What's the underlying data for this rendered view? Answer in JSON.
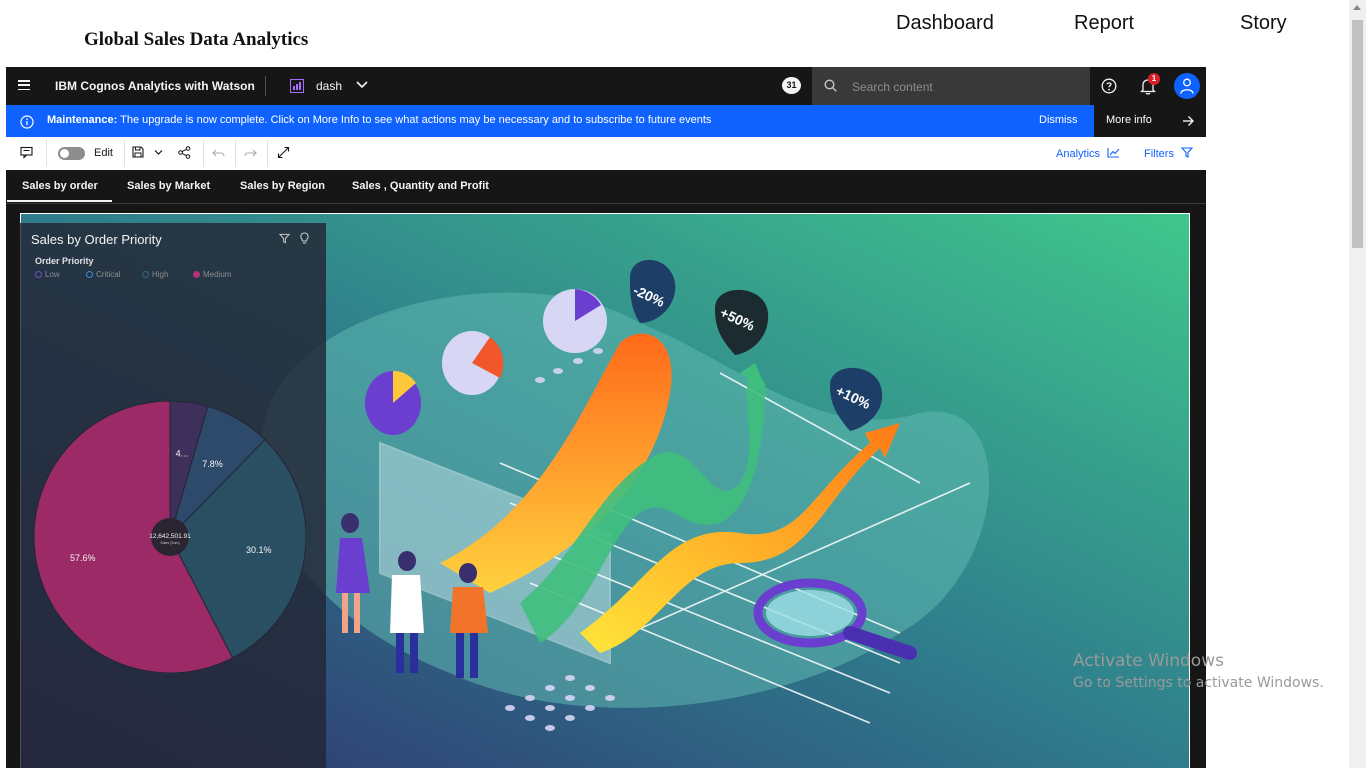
{
  "page": {
    "title": "Global Sales Data Analytics",
    "nav": [
      "Dashboard",
      "Report",
      "Story"
    ]
  },
  "appbar": {
    "product": "IBM Cognos Analytics with Watson",
    "dashboard_name": "dash",
    "counter": "31",
    "search_placeholder": "Search content",
    "notification_count": "1"
  },
  "banner": {
    "label": "Maintenance:",
    "message": "The upgrade is now complete. Click on More Info to see what actions may be necessary and to subscribe to future events",
    "dismiss": "Dismiss",
    "more_info": "More info"
  },
  "toolbar": {
    "edit_label": "Edit",
    "analytics_label": "Analytics",
    "filters_label": "Filters"
  },
  "tabs": [
    "Sales by order",
    "Sales by Market",
    "Sales by Region",
    "Sales , Quantity and Profit"
  ],
  "hero_labels": [
    "-20%",
    "+50%",
    "+10%"
  ],
  "widget": {
    "title": "Sales by Order Priority",
    "legend_title": "Order Priority"
  },
  "chart_data": {
    "type": "pie",
    "title": "Sales by Order Priority",
    "legend_title": "Order Priority",
    "legend": [
      "Low",
      "Critical",
      "High",
      "Medium"
    ],
    "slices": [
      {
        "name": "Low",
        "percent": 4.5,
        "label": "4...",
        "color": "#3e2f5b"
      },
      {
        "name": "Critical",
        "percent": 7.8,
        "label": "7.8%",
        "color": "#2e4a6b"
      },
      {
        "name": "High",
        "percent": 30.1,
        "label": "30.1%",
        "color": "#2a4f63"
      },
      {
        "name": "Medium",
        "percent": 57.6,
        "label": "57.6%",
        "color": "#9b2a66"
      }
    ],
    "center_value": "12,642,501.91",
    "center_label": "Sales (Sum)"
  },
  "watermark": {
    "line1": "Activate Windows",
    "line2": "Go to Settings to activate Windows."
  }
}
